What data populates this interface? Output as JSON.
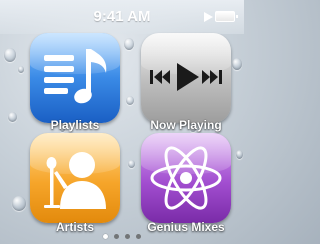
{
  "status_bar": {
    "time": "9:41 AM",
    "playing_icon": "play-icon",
    "battery_icon": "battery-icon"
  },
  "apps": [
    {
      "label": "Playlists",
      "icon": "music-note-list-icon",
      "color": "#2f7fe0"
    },
    {
      "label": "Now Playing",
      "icon": "media-controls-icon",
      "color": "#b0b0b0"
    },
    {
      "label": "Artists",
      "icon": "artist-microphone-icon",
      "color": "#f39c1b"
    },
    {
      "label": "Genius Mixes",
      "icon": "atom-icon",
      "color": "#9b45c9"
    }
  ],
  "page_indicator": {
    "pages": 4,
    "current": 1
  }
}
